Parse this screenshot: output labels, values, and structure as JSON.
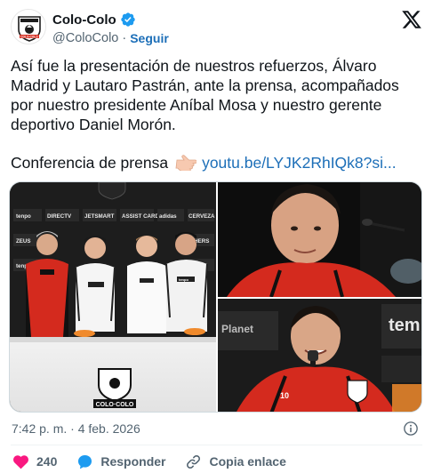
{
  "account": {
    "display_name": "Colo-Colo",
    "handle": "@ColoColo",
    "separator": "·",
    "follow_label": "Seguir"
  },
  "tweet": {
    "text": "Así fue la presentación de nuestros refuerzos, Álvaro Madrid y Lautaro Pastrán, ante la prensa, acompañados por nuestro presidente Aníbal Mosa y nuestro gerente deportivo Daniel Morón.",
    "link_prefix": "Conferencia de prensa",
    "link_text": "youtu.be/LYJK2RhIQk8?si...",
    "timestamp": "7:42 p. m. · 4 feb. 2026"
  },
  "media": {
    "backdrop_sponsor_labels": [
      "tenpo",
      "DIRECTV",
      "JETSMART",
      "ASSIST CARD",
      "adidas",
      "CERVEZA",
      "ZEUS",
      "SKECHERS"
    ],
    "shirt_sponsor": "tenpo",
    "crest_text": "COLO·COLO",
    "player_number": "10",
    "plane_text": "Planet",
    "tenpo_side": "tem"
  },
  "actions": {
    "like_count": "240",
    "reply_label": "Responder",
    "copy_label": "Copia enlace"
  },
  "colors": {
    "link": "#1d6fb8",
    "verified": "#1d9bf0",
    "like": "#f91880",
    "reply": "#1d9bf0",
    "muted": "#536471",
    "jersey_red": "#d42a1e"
  },
  "icons": [
    "colo-colo-crest-icon",
    "verified-badge-icon",
    "x-logo-icon",
    "pointing-right-icon",
    "info-icon",
    "heart-icon",
    "reply-icon",
    "link-icon"
  ]
}
